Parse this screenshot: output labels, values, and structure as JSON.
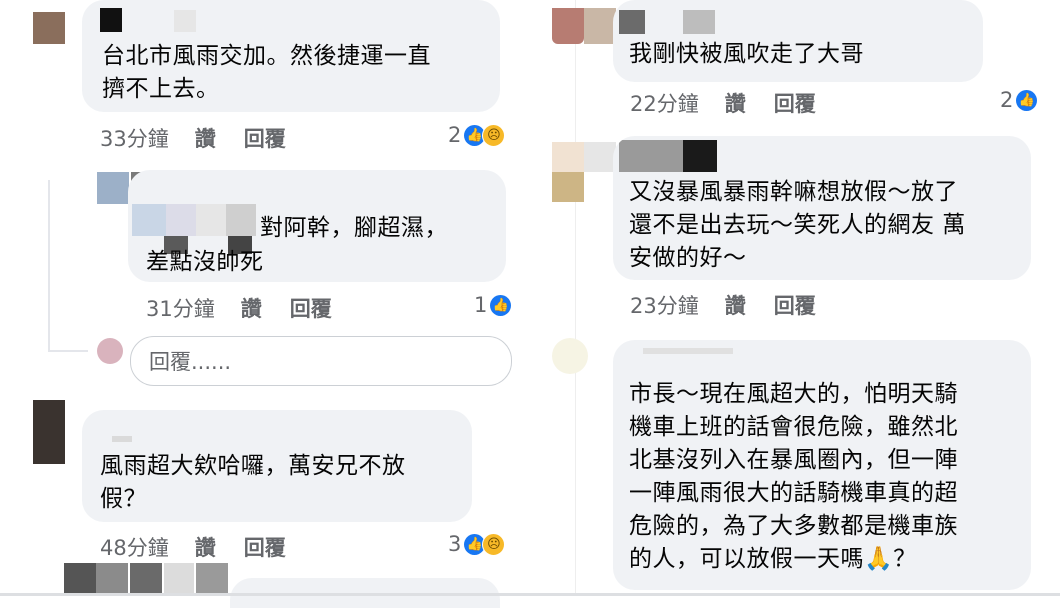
{
  "left": {
    "comment1": {
      "text": "台北市風雨交加。然後捷運一直\n擠不上去。",
      "time": "33分鐘",
      "like": "讚",
      "reply": "回覆",
      "reaction_count": "2"
    },
    "comment2": {
      "text_line1": "對阿幹，腳超濕，",
      "text_line2": "差點沒帥死",
      "time": "31分鐘",
      "like": "讚",
      "reply": "回覆",
      "reaction_count": "1"
    },
    "reply_input": {
      "placeholder": "回覆......"
    },
    "comment3": {
      "text": "風雨超大欸哈囉，萬安兄不放\n假？",
      "time": "48分鐘",
      "like": "讚",
      "reply": "回覆",
      "reaction_count": "3"
    }
  },
  "right": {
    "comment1": {
      "text": "我剛快被風吹走了大哥",
      "time": "22分鐘",
      "like": "讚",
      "reply": "回覆",
      "reaction_count": "2"
    },
    "comment2": {
      "text": "又沒暴風暴雨幹嘛想放假～放了\n還不是出去玩～笑死人的網友 萬\n安做的好～",
      "time": "23分鐘",
      "like": "讚",
      "reply": "回覆"
    },
    "comment3": {
      "text": "市長～現在風超大的，怕明天騎\n機車上班的話會很危險，雖然北\n北基沒列入在暴風圈內，但一陣\n一陣風雨很大的話騎機車真的超\n危險的，為了大多數都是機車族\n的人，可以放假一天嗎🙏？"
    }
  },
  "icons": {
    "like": "thumbs-up-icon",
    "sad": "sad-face-icon"
  },
  "colors": {
    "bubble": "#f0f2f5",
    "meta_text": "#65676b",
    "like_blue": "#1877f2"
  }
}
